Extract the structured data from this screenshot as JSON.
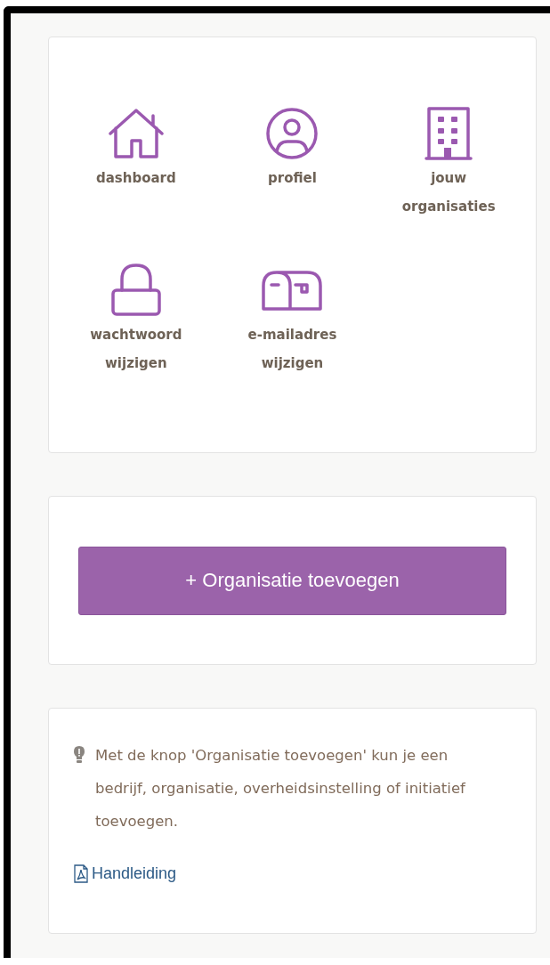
{
  "menu_tiles": [
    {
      "label": "dashboard"
    },
    {
      "label": "profiel"
    },
    {
      "label": "jouw organisaties"
    },
    {
      "label": "wachtwoord wijzigen"
    },
    {
      "label": "e-mailadres wijzigen"
    }
  ],
  "add_button": {
    "label": "+ Organisatie toevoegen"
  },
  "info": {
    "text": "Met de knop 'Organisatie toevoegen' kun je een bedrijf, organisatie, overheidsinstelling of initiatief toevoegen.",
    "link": "Handleiding"
  }
}
